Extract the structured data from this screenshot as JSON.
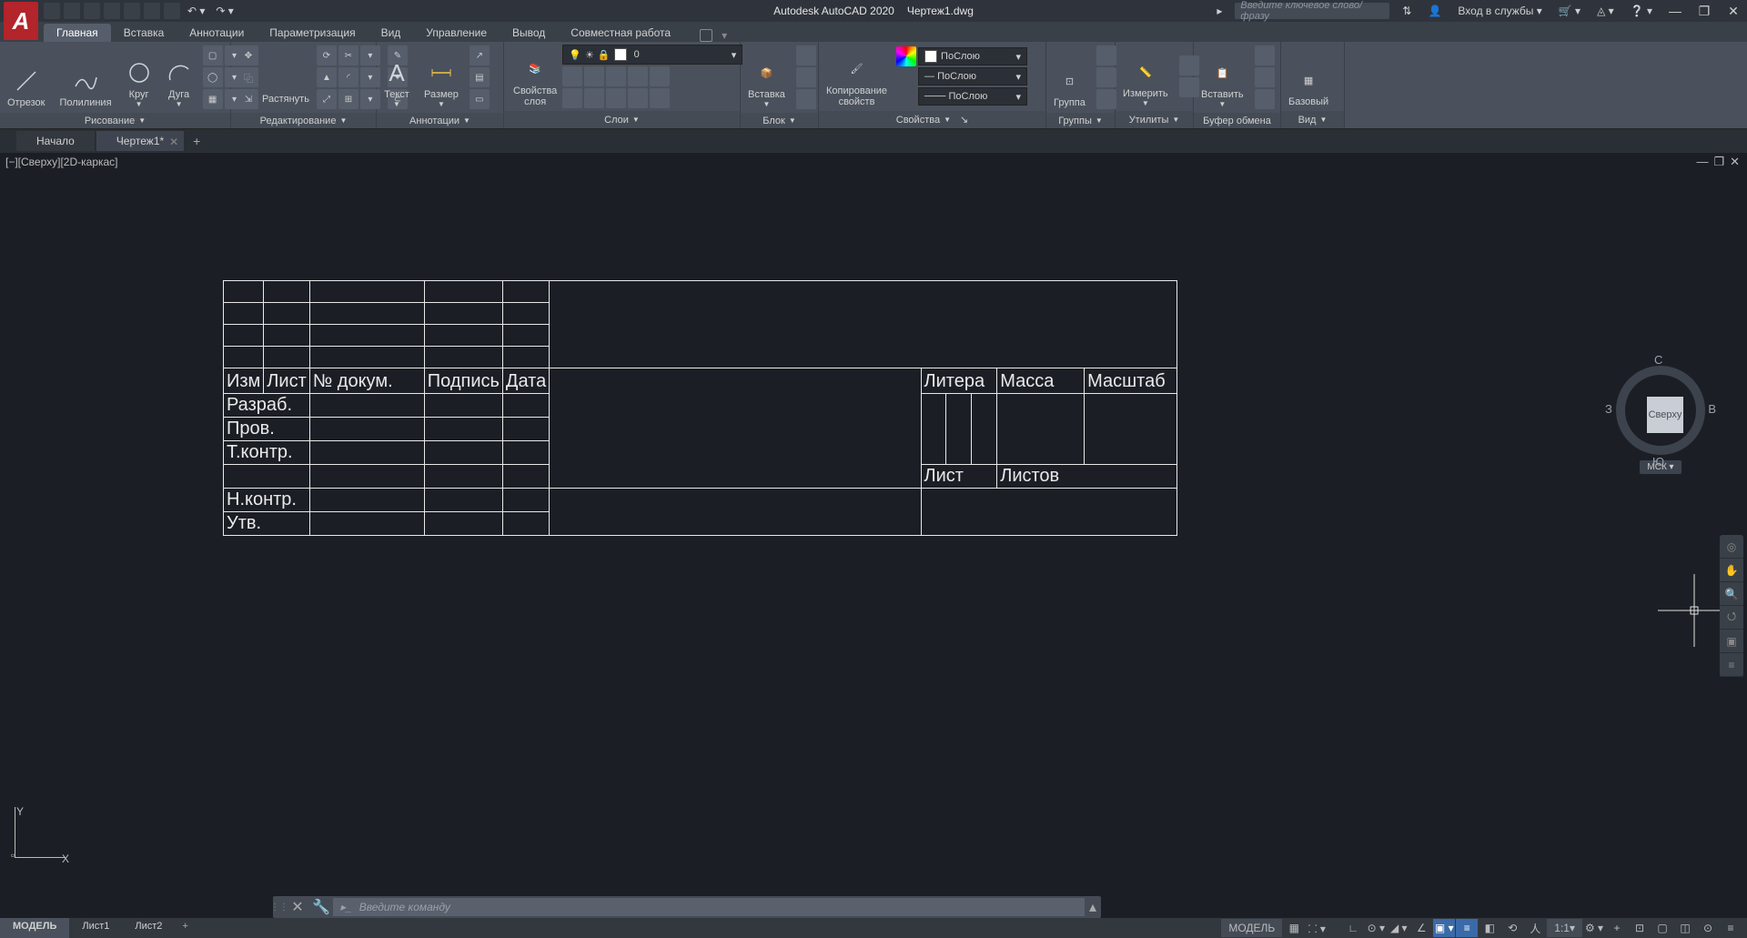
{
  "titlebar": {
    "app_name": "Autodesk AutoCAD 2020",
    "file_name": "Чертеж1.dwg",
    "search_placeholder": "Введите ключевое слово/фразу",
    "signin": "Вход в службы"
  },
  "tabs": [
    "Главная",
    "Вставка",
    "Аннотации",
    "Параметризация",
    "Вид",
    "Управление",
    "Вывод",
    "Совместная работа"
  ],
  "active_tab": 0,
  "ribbon": {
    "draw": {
      "title": "Рисование",
      "line": "Отрезок",
      "polyline": "Полилиния",
      "circle": "Круг",
      "arc": "Дуга"
    },
    "modify": {
      "title": "Редактирование",
      "stretch": "Растянуть"
    },
    "annot": {
      "title": "Аннотации",
      "text": "Текст",
      "dim": "Размер"
    },
    "layers": {
      "title": "Слои",
      "props": "Свойства\nслоя",
      "current": "0"
    },
    "block": {
      "title": "Блок",
      "insert": "Вставка"
    },
    "props": {
      "title": "Свойства",
      "match": "Копирование\nсвойств",
      "bylayer": "ПоСлою"
    },
    "groups": {
      "title": "Группы",
      "group": "Группа"
    },
    "utils": {
      "title": "Утилиты",
      "measure": "Измерить"
    },
    "clip": {
      "title": "Буфер обмена",
      "paste": "Вставить"
    },
    "view": {
      "title": "Вид",
      "base": "Базовый"
    }
  },
  "filetabs": {
    "start": "Начало",
    "file": "Чертеж1*"
  },
  "viewport_label": "[−][Сверху][2D-каркас]",
  "viewcube": {
    "top": "Сверху",
    "n": "С",
    "s": "Ю",
    "e": "В",
    "w": "З",
    "wcs": "МСК"
  },
  "ucs": {
    "x": "X",
    "y": "Y"
  },
  "cmdline": {
    "placeholder": "Введите команду"
  },
  "status": {
    "model": "МОДЕЛЬ",
    "model_space": "МОДЕЛЬ",
    "sheet1": "Лист1",
    "sheet2": "Лист2",
    "scale": "1:1"
  },
  "stamp": {
    "izm": "Изм",
    "list": "Лист",
    "docnum": "№ докум.",
    "sign": "Подпись",
    "date": "Дата",
    "razrab": "Разраб.",
    "prov": "Пров.",
    "tkontr": "Т.контр.",
    "nkontr": "Н.контр.",
    "utv": "Утв.",
    "litera": "Литера",
    "massa": "Масса",
    "mashtab": "Масштаб",
    "list2": "Лист",
    "listov": "Листов"
  }
}
